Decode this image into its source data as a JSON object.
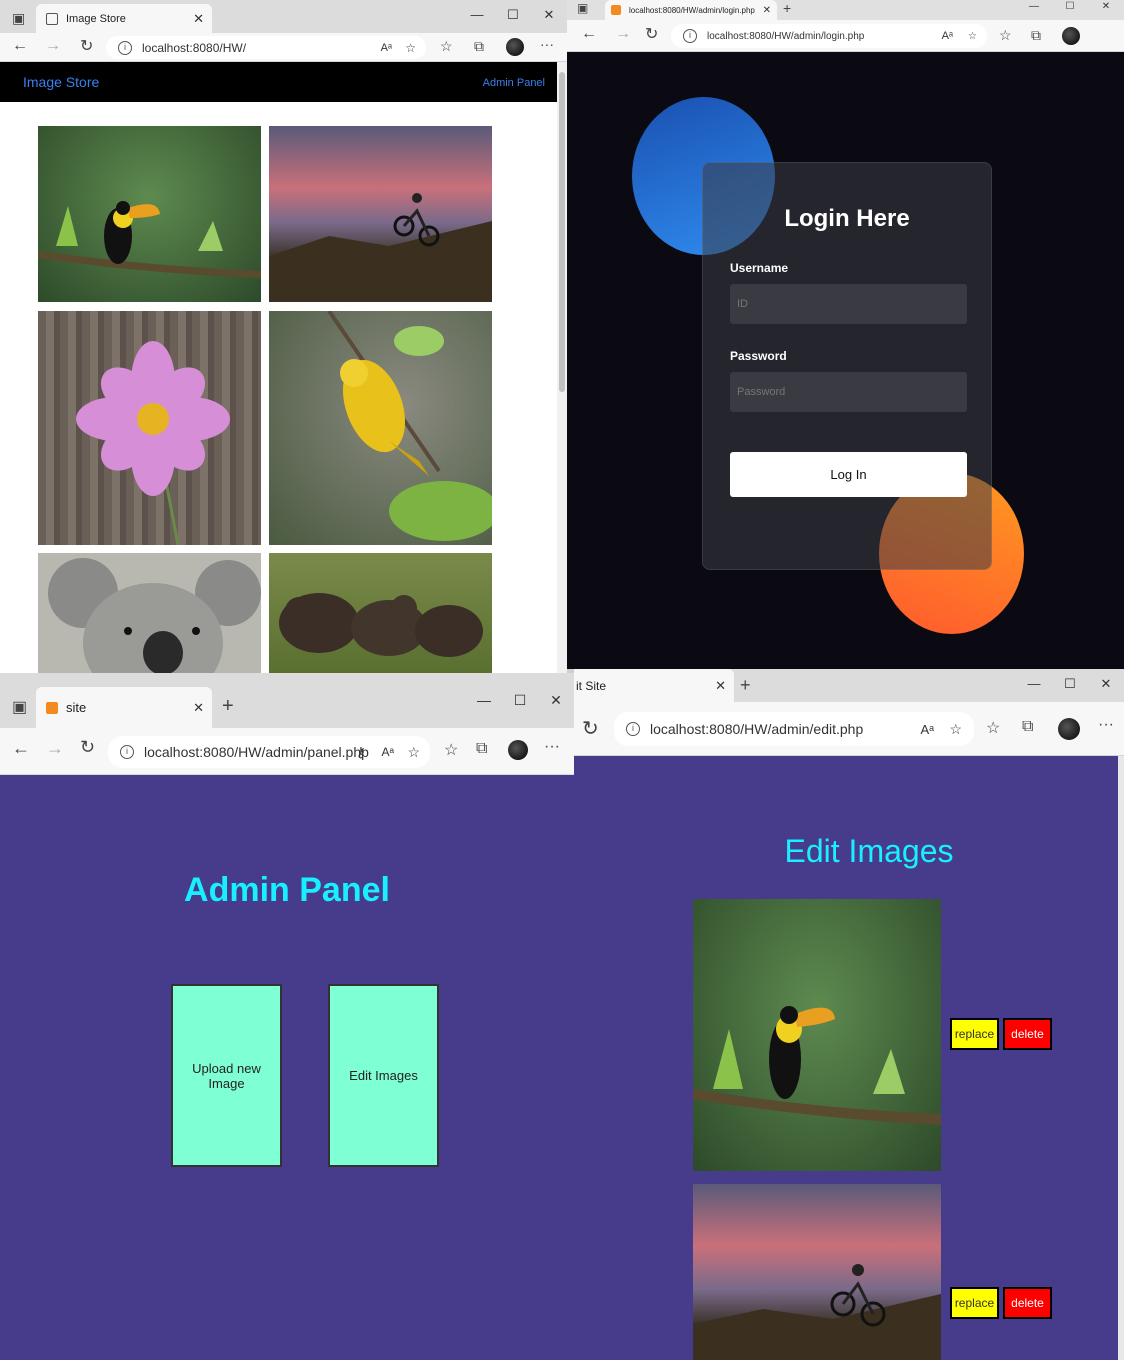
{
  "store_window": {
    "tab_title": "Image Store",
    "url": "localhost:8080/HW/",
    "header_title": "Image Store",
    "admin_link": "Admin Panel",
    "images": [
      "toucan on branch",
      "mountain biker at sunset",
      "pink cosmos flower",
      "yellow bird on branch",
      "koala",
      "bear cubs in grass"
    ]
  },
  "login_window": {
    "tab_title": "localhost:8080/HW/admin/login.php",
    "url": "localhost:8080/HW/admin/login.php",
    "title": "Login Here",
    "username_label": "Username",
    "username_placeholder": "ID",
    "password_label": "Password",
    "password_placeholder": "Password",
    "login_button": "Log In",
    "colors": {
      "blue_circle": "#1f6fe0",
      "orange_circle": "#ff6a3d",
      "background": "#0b0a12"
    }
  },
  "panel_window": {
    "tab_title": "site",
    "url": "localhost:8080/HW/admin/panel.php",
    "title": "Admin Panel",
    "cards": [
      "Upload new Image",
      "Edit Images"
    ],
    "colors": {
      "background": "#473c8b",
      "title": "#19f0ff",
      "card": "#7fffd4"
    }
  },
  "edit_window": {
    "tab_title": "it Site",
    "url": "localhost:8080/HW/admin/edit.php",
    "title": "Edit Images",
    "replace_label": "replace",
    "delete_label": "delete",
    "images": [
      "toucan on branch",
      "mountain biker at sunset"
    ]
  }
}
